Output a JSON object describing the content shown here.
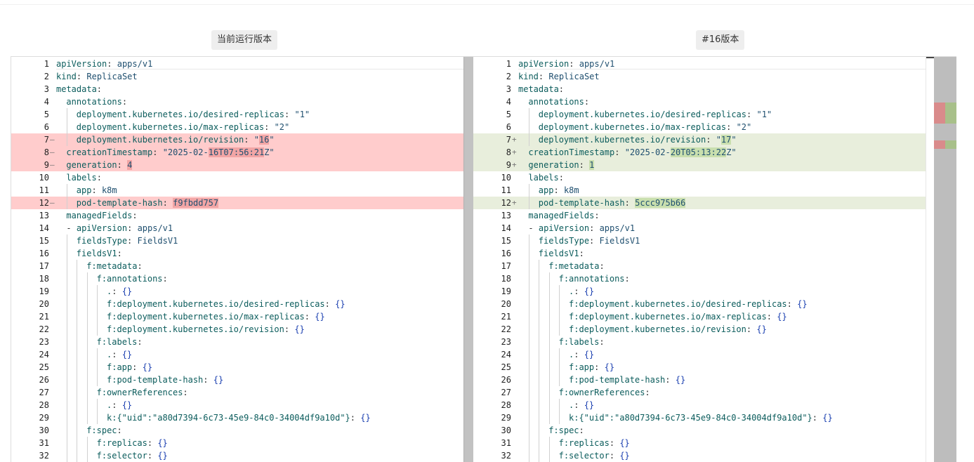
{
  "titles": {
    "left": "当前运行版本",
    "right": "#16版本"
  },
  "colors": {
    "deleted_line": "#ffcccc",
    "inserted_line": "#e8eedc",
    "deleted_token": "#f2a5a5",
    "inserted_token": "#c9dfae",
    "overview_deleted": "#d98b8b",
    "overview_inserted": "#a8c08a"
  },
  "left": {
    "lines": [
      {
        "n": "1",
        "m": "",
        "indent": 0,
        "key": "apiVersion",
        "val": "apps/v1"
      },
      {
        "n": "2",
        "m": "",
        "indent": 0,
        "key": "kind",
        "val": "ReplicaSet"
      },
      {
        "n": "3",
        "m": "",
        "indent": 0,
        "key": "metadata",
        "val": ""
      },
      {
        "n": "4",
        "m": "",
        "indent": 1,
        "key": "annotations",
        "val": ""
      },
      {
        "n": "5",
        "m": "",
        "indent": 2,
        "key": "deployment.kubernetes.io/desired-replicas",
        "val": "\"1\""
      },
      {
        "n": "6",
        "m": "",
        "indent": 2,
        "key": "deployment.kubernetes.io/max-replicas",
        "val": "\"2\""
      },
      {
        "n": "7",
        "m": "—",
        "indent": 2,
        "key": "deployment.kubernetes.io/revision",
        "val": "\"16\"",
        "type": "del",
        "pre": "\"",
        "hl": "16",
        "post": "\""
      },
      {
        "n": "8",
        "m": "—",
        "indent": 1,
        "key": "creationTimestamp",
        "val": "\"2025-02-16T07:56:21Z\"",
        "type": "del",
        "pre": "\"2025-02-",
        "hl": "16T07:56:21",
        "post": "Z\""
      },
      {
        "n": "9",
        "m": "—",
        "indent": 1,
        "key": "generation",
        "val": "4",
        "type": "del",
        "pre": "",
        "hl": "4",
        "post": ""
      },
      {
        "n": "10",
        "m": "",
        "indent": 1,
        "key": "labels",
        "val": ""
      },
      {
        "n": "11",
        "m": "",
        "indent": 2,
        "key": "app",
        "val": "k8m"
      },
      {
        "n": "12",
        "m": "—",
        "indent": 2,
        "key": "pod-template-hash",
        "val": "f9fbdd757",
        "type": "del",
        "pre": "",
        "hl": "f9fbdd757",
        "post": ""
      },
      {
        "n": "13",
        "m": "",
        "indent": 1,
        "key": "managedFields",
        "val": ""
      },
      {
        "n": "14",
        "m": "",
        "indent": 1,
        "key": "apiVersion",
        "val": "apps/v1",
        "dash": true
      },
      {
        "n": "15",
        "m": "",
        "indent": 2,
        "key": "fieldsType",
        "val": "FieldsV1"
      },
      {
        "n": "16",
        "m": "",
        "indent": 2,
        "key": "fieldsV1",
        "val": ""
      },
      {
        "n": "17",
        "m": "",
        "indent": 3,
        "key": "f:metadata",
        "val": ""
      },
      {
        "n": "18",
        "m": "",
        "indent": 4,
        "key": "f:annotations",
        "val": ""
      },
      {
        "n": "19",
        "m": "",
        "indent": 5,
        "key": ".",
        "val": "{}"
      },
      {
        "n": "20",
        "m": "",
        "indent": 5,
        "key": "f:deployment.kubernetes.io/desired-replicas",
        "val": "{}"
      },
      {
        "n": "21",
        "m": "",
        "indent": 5,
        "key": "f:deployment.kubernetes.io/max-replicas",
        "val": "{}"
      },
      {
        "n": "22",
        "m": "",
        "indent": 5,
        "key": "f:deployment.kubernetes.io/revision",
        "val": "{}"
      },
      {
        "n": "23",
        "m": "",
        "indent": 4,
        "key": "f:labels",
        "val": ""
      },
      {
        "n": "24",
        "m": "",
        "indent": 5,
        "key": ".",
        "val": "{}"
      },
      {
        "n": "25",
        "m": "",
        "indent": 5,
        "key": "f:app",
        "val": "{}"
      },
      {
        "n": "26",
        "m": "",
        "indent": 5,
        "key": "f:pod-template-hash",
        "val": "{}"
      },
      {
        "n": "27",
        "m": "",
        "indent": 4,
        "key": "f:ownerReferences",
        "val": ""
      },
      {
        "n": "28",
        "m": "",
        "indent": 5,
        "key": ".",
        "val": "{}"
      },
      {
        "n": "29",
        "m": "",
        "indent": 5,
        "key": "k:{\"uid\":\"a80d7394-6c73-45e9-84c0-34004df9a10d\"}",
        "val": "{}"
      },
      {
        "n": "30",
        "m": "",
        "indent": 3,
        "key": "f:spec",
        "val": ""
      },
      {
        "n": "31",
        "m": "",
        "indent": 4,
        "key": "f:replicas",
        "val": "{}"
      },
      {
        "n": "32",
        "m": "",
        "indent": 4,
        "key": "f:selector",
        "val": "{}"
      }
    ]
  },
  "right": {
    "lines": [
      {
        "n": "1",
        "m": "",
        "indent": 0,
        "key": "apiVersion",
        "val": "apps/v1"
      },
      {
        "n": "2",
        "m": "",
        "indent": 0,
        "key": "kind",
        "val": "ReplicaSet"
      },
      {
        "n": "3",
        "m": "",
        "indent": 0,
        "key": "metadata",
        "val": ""
      },
      {
        "n": "4",
        "m": "",
        "indent": 1,
        "key": "annotations",
        "val": ""
      },
      {
        "n": "5",
        "m": "",
        "indent": 2,
        "key": "deployment.kubernetes.io/desired-replicas",
        "val": "\"1\""
      },
      {
        "n": "6",
        "m": "",
        "indent": 2,
        "key": "deployment.kubernetes.io/max-replicas",
        "val": "\"2\""
      },
      {
        "n": "7",
        "m": "+",
        "indent": 2,
        "key": "deployment.kubernetes.io/revision",
        "val": "\"17\"",
        "type": "ins",
        "pre": "\"",
        "hl": "17",
        "post": "\""
      },
      {
        "n": "8",
        "m": "+",
        "indent": 1,
        "key": "creationTimestamp",
        "val": "\"2025-02-20T05:13:22Z\"",
        "type": "ins",
        "pre": "\"2025-02-",
        "hl": "20T05:13:22",
        "post": "Z\""
      },
      {
        "n": "9",
        "m": "+",
        "indent": 1,
        "key": "generation",
        "val": "1",
        "type": "ins",
        "pre": "",
        "hl": "1",
        "post": ""
      },
      {
        "n": "10",
        "m": "",
        "indent": 1,
        "key": "labels",
        "val": ""
      },
      {
        "n": "11",
        "m": "",
        "indent": 2,
        "key": "app",
        "val": "k8m"
      },
      {
        "n": "12",
        "m": "+",
        "indent": 2,
        "key": "pod-template-hash",
        "val": "5ccc975b66",
        "type": "ins",
        "pre": "",
        "hl": "5ccc975b66",
        "post": ""
      },
      {
        "n": "13",
        "m": "",
        "indent": 1,
        "key": "managedFields",
        "val": ""
      },
      {
        "n": "14",
        "m": "",
        "indent": 1,
        "key": "apiVersion",
        "val": "apps/v1",
        "dash": true
      },
      {
        "n": "15",
        "m": "",
        "indent": 2,
        "key": "fieldsType",
        "val": "FieldsV1"
      },
      {
        "n": "16",
        "m": "",
        "indent": 2,
        "key": "fieldsV1",
        "val": ""
      },
      {
        "n": "17",
        "m": "",
        "indent": 3,
        "key": "f:metadata",
        "val": ""
      },
      {
        "n": "18",
        "m": "",
        "indent": 4,
        "key": "f:annotations",
        "val": ""
      },
      {
        "n": "19",
        "m": "",
        "indent": 5,
        "key": ".",
        "val": "{}"
      },
      {
        "n": "20",
        "m": "",
        "indent": 5,
        "key": "f:deployment.kubernetes.io/desired-replicas",
        "val": "{}"
      },
      {
        "n": "21",
        "m": "",
        "indent": 5,
        "key": "f:deployment.kubernetes.io/max-replicas",
        "val": "{}"
      },
      {
        "n": "22",
        "m": "",
        "indent": 5,
        "key": "f:deployment.kubernetes.io/revision",
        "val": "{}"
      },
      {
        "n": "23",
        "m": "",
        "indent": 4,
        "key": "f:labels",
        "val": ""
      },
      {
        "n": "24",
        "m": "",
        "indent": 5,
        "key": ".",
        "val": "{}"
      },
      {
        "n": "25",
        "m": "",
        "indent": 5,
        "key": "f:app",
        "val": "{}"
      },
      {
        "n": "26",
        "m": "",
        "indent": 5,
        "key": "f:pod-template-hash",
        "val": "{}"
      },
      {
        "n": "27",
        "m": "",
        "indent": 4,
        "key": "f:ownerReferences",
        "val": ""
      },
      {
        "n": "28",
        "m": "",
        "indent": 5,
        "key": ".",
        "val": "{}"
      },
      {
        "n": "29",
        "m": "",
        "indent": 5,
        "key": "k:{\"uid\":\"a80d7394-6c73-45e9-84c0-34004df9a10d\"}",
        "val": "{}"
      },
      {
        "n": "30",
        "m": "",
        "indent": 3,
        "key": "f:spec",
        "val": ""
      },
      {
        "n": "31",
        "m": "",
        "indent": 4,
        "key": "f:replicas",
        "val": "{}"
      },
      {
        "n": "32",
        "m": "",
        "indent": 4,
        "key": "f:selector",
        "val": "{}"
      }
    ]
  },
  "overview": {
    "markers": [
      {
        "line_from": 7,
        "line_to": 9
      },
      {
        "line_from": 12,
        "line_to": 12
      }
    ]
  }
}
